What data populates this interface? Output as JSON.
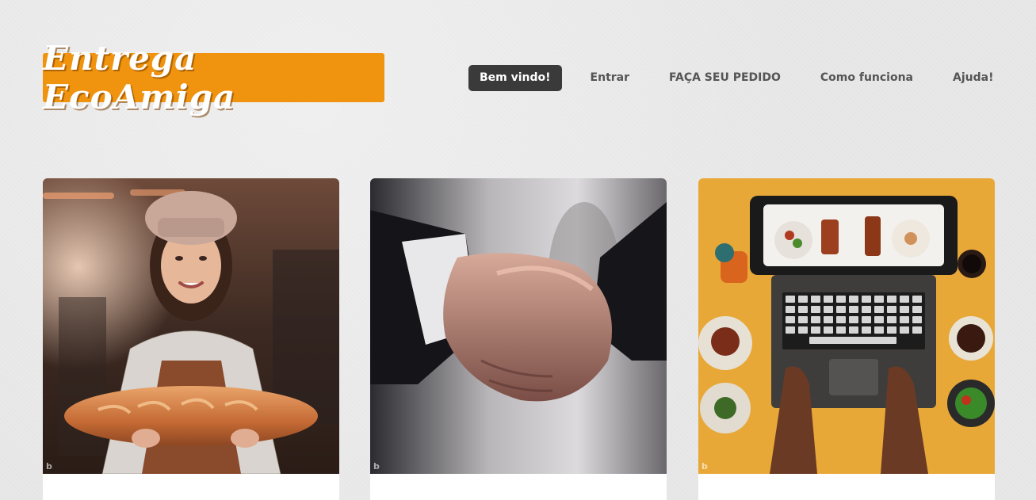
{
  "brand": {
    "name": "Entrega EcoAmiga",
    "color": "#f0940f"
  },
  "nav": {
    "items": [
      {
        "label": "Bem vindo!",
        "active": true
      },
      {
        "label": "Entrar",
        "active": false
      },
      {
        "label": "FAÇA SEU PEDIDO",
        "active": false
      },
      {
        "label": "Como funciona",
        "active": false
      },
      {
        "label": "Ajuda!",
        "active": false
      }
    ]
  },
  "cards": [
    {
      "image": "baker-with-bread-photo",
      "watermark": "b"
    },
    {
      "image": "handshake-photo",
      "watermark": "b"
    },
    {
      "image": "laptop-food-ordering-photo",
      "watermark": "b"
    }
  ]
}
